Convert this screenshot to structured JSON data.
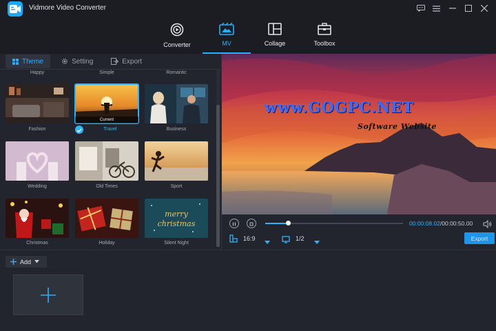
{
  "app": {
    "title": "Vidmore Video Converter"
  },
  "main_tabs": [
    {
      "label": "Converter",
      "icon": "converter-icon"
    },
    {
      "label": "MV",
      "icon": "mv-icon",
      "active": true
    },
    {
      "label": "Collage",
      "icon": "collage-icon"
    },
    {
      "label": "Toolbox",
      "icon": "toolbox-icon"
    }
  ],
  "sub_tabs": [
    {
      "label": "Theme",
      "active": true
    },
    {
      "label": "Setting"
    },
    {
      "label": "Export"
    }
  ],
  "themes_partial_row": [
    "Happy",
    "Simple",
    "Romantic"
  ],
  "themes": [
    {
      "label": "Fashion"
    },
    {
      "label": "Travel",
      "selected": true,
      "tag": "Current"
    },
    {
      "label": "Business"
    },
    {
      "label": "Wedding"
    },
    {
      "label": "Old Times"
    },
    {
      "label": "Sport"
    },
    {
      "label": "Christmas"
    },
    {
      "label": "Holiday"
    },
    {
      "label": "Silent Night",
      "overlay_text_1": "merry",
      "overlay_text_2": "christmas"
    }
  ],
  "add_button": {
    "label": "Add"
  },
  "preview": {
    "watermark_main": "www.GOGPC.NET",
    "watermark_sub": "Software Website"
  },
  "playback": {
    "current_time": "00:00:08.02",
    "total_time": "/00:00:50.00",
    "progress": 0.165
  },
  "aspect_ratio": "16:9",
  "screen": "1/2",
  "export_button": {
    "label": "Export"
  },
  "colors": {
    "accent": "#27b0ff",
    "background": "#22252d",
    "titlebar": "#1b1d23"
  }
}
